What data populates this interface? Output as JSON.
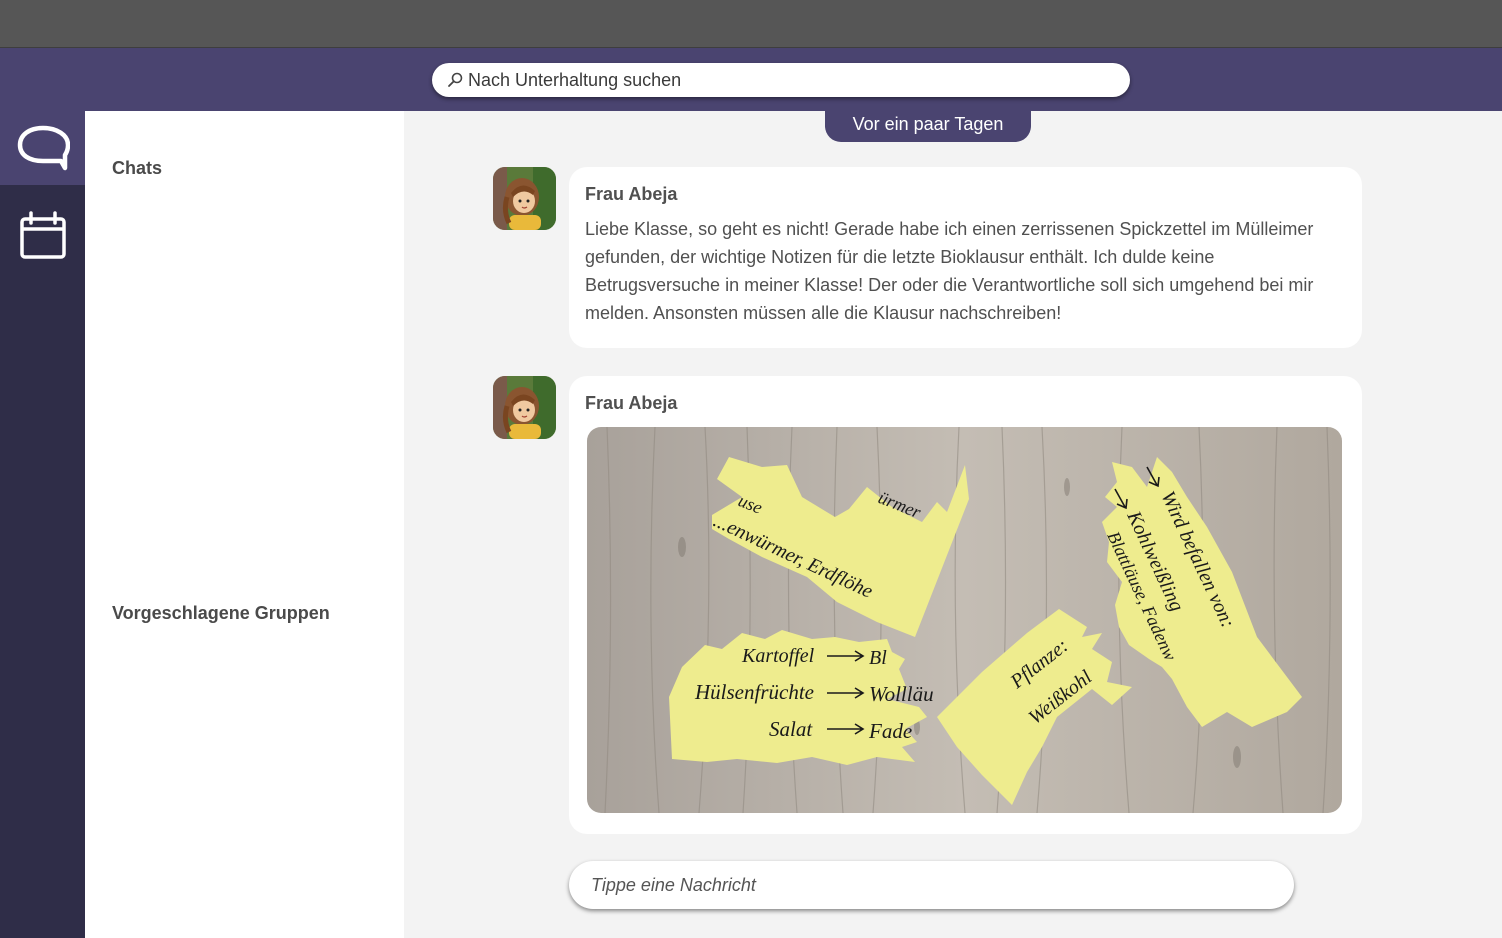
{
  "search": {
    "placeholder": "Nach Unterhaltung suchen"
  },
  "rail": {
    "items": [
      {
        "icon": "chat-bubble-icon",
        "active": true
      },
      {
        "icon": "calendar-icon",
        "active": false
      }
    ]
  },
  "sidebar": {
    "chats_heading": "Chats",
    "groups_heading": "Vorgeschlagene Gruppen"
  },
  "chat": {
    "date_label": "Vor ein paar Tagen",
    "messages": [
      {
        "author": "Frau Abeja",
        "text": "Liebe Klasse, so geht es nicht! Gerade habe ich einen zerrissenen Spickzettel im Mülleimer gefunden, der wichtige Notizen für die letzte Bioklausur enthält. Ich dulde keine Betrugsversuche in meiner Klasse! Der oder die Verantwortliche soll sich umgehend bei mir melden. Ansonsten müssen alle die Klausur nachschreiben!"
      },
      {
        "author": "Frau Abeja",
        "image": {
          "snippets": [
            "use",
            "ürmer",
            "...enwürmer, Erdflöhe",
            "Kartoffel",
            "Bl",
            "Hülsenfrüchte",
            "Wollläu",
            "Salat",
            "Fade",
            "Pflanze:",
            "Weißkohl",
            "Wird befallen von:",
            "Kohlweißling",
            "Blattläuse, Fadenw"
          ]
        }
      }
    ],
    "composer_placeholder": "Tippe eine Nachricht"
  },
  "colors": {
    "accent": "#4a4470",
    "rail": "#2f2d48",
    "note": "#eeec8e",
    "wood": "#b8b0a6"
  }
}
